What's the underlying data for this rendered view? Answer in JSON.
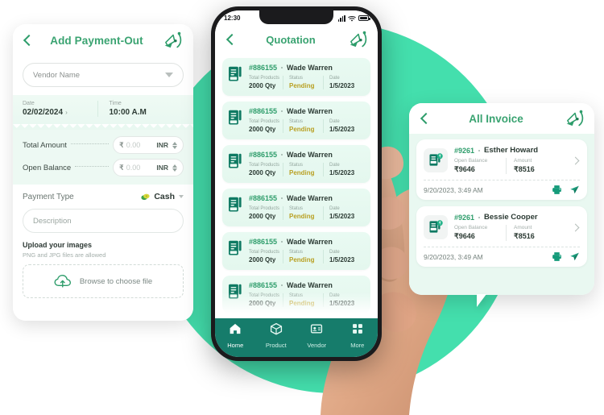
{
  "brand": {
    "logo_icon": "brand-bird-logo",
    "accent": "#3aa371",
    "circle_color": "#44dfad",
    "nav_bg": "#167c6b"
  },
  "left_panel": {
    "title": "Add Payment-Out",
    "back_icon": "back-chevron-icon",
    "vendor": {
      "placeholder": "Vendor Name",
      "dropdown_icon": "caret-down-icon"
    },
    "date": {
      "label": "Date",
      "value": "02/02/2024",
      "chevron": "›"
    },
    "time": {
      "label": "Time",
      "value": "10:00 A.M"
    },
    "total_amount": {
      "label": "Total Amount",
      "symbol": "₹",
      "value": "0.00",
      "currency": "INR"
    },
    "open_balance": {
      "label": "Open Balance",
      "symbol": "₹",
      "value": "0.00",
      "currency": "INR"
    },
    "payment_type": {
      "label": "Payment Type",
      "value": "Cash",
      "icon": "cash-money-icon"
    },
    "description": {
      "placeholder": "Description"
    },
    "upload": {
      "title": "Upload your images",
      "subtitle": "PNG and JPG files are allowed",
      "button_label": "Browse to choose file",
      "icon": "cloud-upload-icon"
    }
  },
  "phone": {
    "status_bar": {
      "time": "12:30",
      "signal_icon": "signal-bars-icon",
      "wifi_icon": "wifi-icon",
      "battery_icon": "battery-icon"
    },
    "title": "Quotation",
    "back_icon": "back-chevron-icon",
    "columns": {
      "products": "Total Products",
      "status": "Status",
      "date": "Date"
    },
    "quotations": [
      {
        "id": "#886155",
        "name": "Wade Warren",
        "qty": "2000 Qty",
        "status": "Pending",
        "date": "1/5/2023"
      },
      {
        "id": "#886155",
        "name": "Wade Warren",
        "qty": "2000 Qty",
        "status": "Pending",
        "date": "1/5/2023"
      },
      {
        "id": "#886155",
        "name": "Wade Warren",
        "qty": "2000 Qty",
        "status": "Pending",
        "date": "1/5/2023"
      },
      {
        "id": "#886155",
        "name": "Wade Warren",
        "qty": "2000 Qty",
        "status": "Pending",
        "date": "1/5/2023"
      },
      {
        "id": "#886155",
        "name": "Wade Warren",
        "qty": "2000 Qty",
        "status": "Pending",
        "date": "1/5/2023"
      },
      {
        "id": "#886155",
        "name": "Wade Warren",
        "qty": "2000 Qty",
        "status": "Pending",
        "date": "1/5/2023"
      }
    ],
    "nav": [
      {
        "label": "Home",
        "icon": "home-icon"
      },
      {
        "label": "Product",
        "icon": "box-icon"
      },
      {
        "label": "Vendor",
        "icon": "vendor-card-icon"
      },
      {
        "label": "More",
        "icon": "grid-more-icon"
      }
    ]
  },
  "right_panel": {
    "title": "All Invoice",
    "back_icon": "back-chevron-icon",
    "columns": {
      "open_balance": "Open Balance",
      "amount": "Amount"
    },
    "invoices": [
      {
        "id": "#9261",
        "name": "Esther Howard",
        "open_balance": "₹9646",
        "amount": "₹8516",
        "datetime": "9/20/2023, 3:49 AM",
        "print_icon": "printer-icon",
        "send_icon": "send-plane-icon"
      },
      {
        "id": "#9261",
        "name": "Bessie Cooper",
        "open_balance": "₹9646",
        "amount": "₹8516",
        "datetime": "9/20/2023, 3:49 AM",
        "print_icon": "printer-icon",
        "send_icon": "send-plane-icon"
      }
    ]
  }
}
